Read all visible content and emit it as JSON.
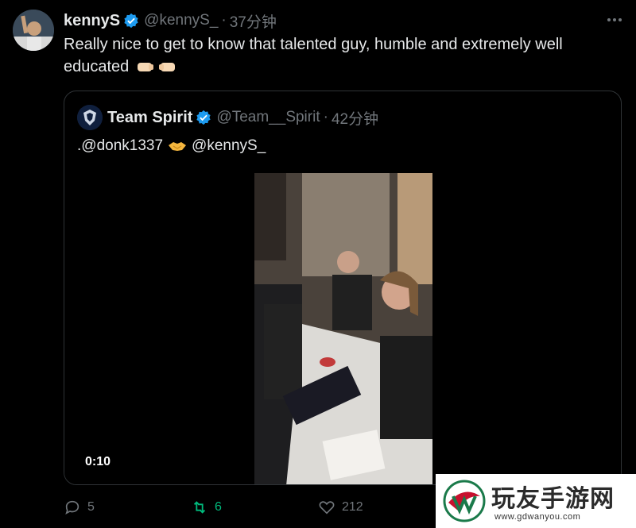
{
  "tweet": {
    "author_name": "kennyS",
    "author_handle": "@kennyS_",
    "separator": "·",
    "time": "37分钟",
    "text": "Really nice to get to know that talented guy, humble and extremely well educated",
    "emoji": [
      "left-facing-fist",
      "right-facing-fist"
    ],
    "more_icon": "more-icon"
  },
  "quote": {
    "author_name": "Team Spirit",
    "author_handle": "@Team__Spirit",
    "separator": "·",
    "time": "42分钟",
    "mention_1": ".@donk1337",
    "mention_2": "@kennyS_",
    "emoji": "handshake",
    "video_timestamp": "0:10"
  },
  "actions": {
    "replies": "5",
    "retweets": "6",
    "likes": "212"
  },
  "watermark": {
    "title": "玩友手游网",
    "url": "www.gdwanyou.com"
  },
  "colors": {
    "background": "#000000",
    "text": "#e7e9ea",
    "muted": "#71767b",
    "verified": "#1d9bf0",
    "retweet_active": "#00ba7c",
    "border": "#2f3336"
  }
}
